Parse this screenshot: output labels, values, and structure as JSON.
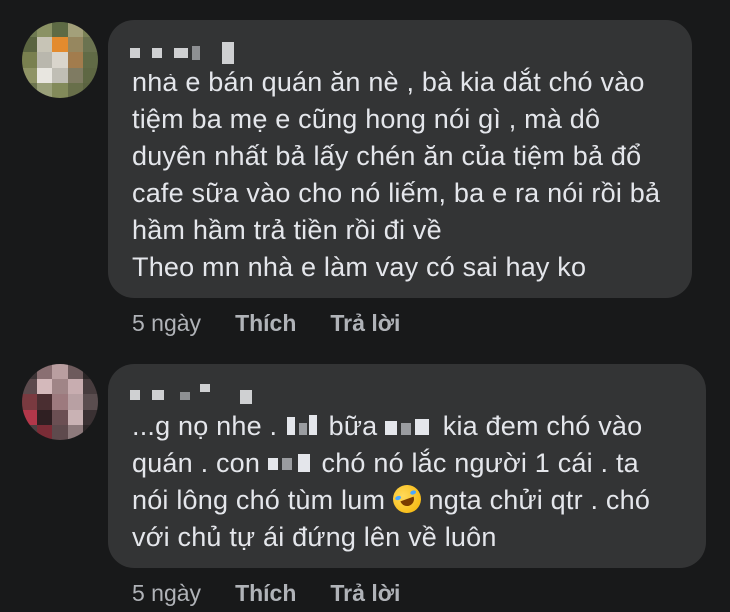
{
  "comments": [
    {
      "lines": [
        "nhà e bán quán ăn nè , bà kia dắt chó vào",
        "tiệm ba mẹ e cũng hong nói gì , mà dô",
        "duyên nhất bả lấy chén ăn của tiệm bả đổ",
        "cafe sữa vào cho nó liếm, ba e ra nói rồi bả",
        "hầm hầm trả tiền rồi đi về",
        "Theo mn nhà e làm vay có sai hay ko"
      ],
      "time": "5 ngày",
      "like": "Thích",
      "reply": "Trả lời"
    },
    {
      "line1": {
        "a": "...g nọ nhe . ",
        "b": " bữa ",
        "c": " kia đem chó vào"
      },
      "line2": {
        "a": "quán . con ",
        "b": " chó nó lắc người 1 cái . ta"
      },
      "line3": {
        "a": "nói lông chó tùm lum ",
        "b": " ngta chửi qtr . chó"
      },
      "line4": "với chủ tự ái đứng lên về luôn",
      "time": "5 ngày",
      "like": "Thích",
      "reply": "Trả lời"
    }
  ],
  "colors": {
    "background": "#18191a",
    "bubble": "#333435",
    "text": "#e4e6eb",
    "meta": "#b0b3b8"
  },
  "icons": {
    "emoji": "rolling-on-floor-laughing-emoji"
  }
}
